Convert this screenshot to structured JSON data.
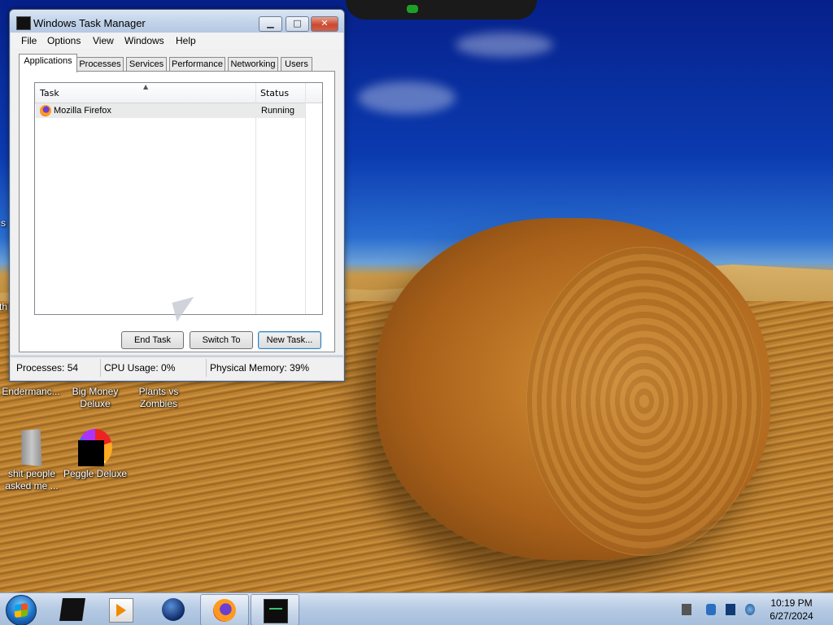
{
  "window": {
    "title": "Windows Task Manager",
    "controls": {
      "minimize": "▁",
      "maximize": "□",
      "close": "✕"
    },
    "menu": [
      "File",
      "Options",
      "View",
      "Windows",
      "Help"
    ],
    "tabs": [
      "Applications",
      "Processes",
      "Services",
      "Performance",
      "Networking",
      "Users"
    ],
    "active_tab": "Applications",
    "table": {
      "columns": [
        "Task",
        "Status"
      ],
      "rows": [
        {
          "task": "Mozilla Firefox",
          "status": "Running",
          "icon": "firefox-icon"
        }
      ]
    },
    "buttons": {
      "end_task": "End Task",
      "switch_to": "Switch To",
      "new_task": "New Task..."
    },
    "status_bar": {
      "processes": "Processes: 54",
      "cpu": "CPU Usage: 0%",
      "memory": "Physical Memory: 39%"
    }
  },
  "desktop": {
    "icons": [
      {
        "label": "Endermanc...",
        "icon": "app-icon"
      },
      {
        "label": "Big Money Deluxe",
        "icon": "app-icon"
      },
      {
        "label": "Plants vs Zombies",
        "icon": "app-icon"
      },
      {
        "label": "shit people asked me ...",
        "icon": "folder-icon"
      },
      {
        "label": "Peggle Deluxe",
        "icon": "peggle-icon"
      }
    ],
    "edge_text": [
      "s",
      "th"
    ]
  },
  "taskbar": {
    "items": [
      "start-orb",
      "cube-app-icon",
      "media-player-icon",
      "globe-icon",
      "firefox-icon",
      "task-manager-icon"
    ],
    "clock": {
      "time": "10:19 PM",
      "date": "6/27/2024"
    }
  },
  "colors": {
    "title_bar": "#c3d4ea",
    "close_button": "#c94a30",
    "taskbar": "#b4c9e2",
    "sky": "#0b3bb0",
    "hay": "#c07a28"
  }
}
